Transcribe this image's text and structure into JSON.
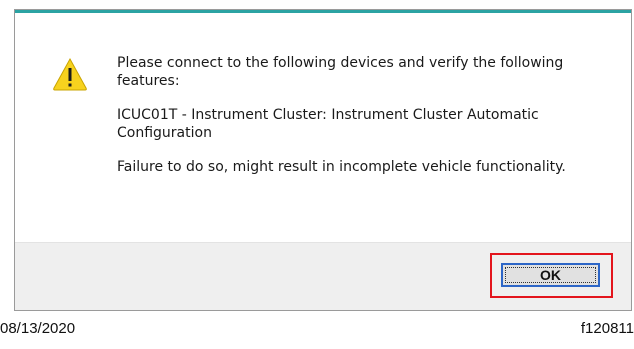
{
  "dialog": {
    "message_lines": [
      "Please connect to the following devices and verify the following features:",
      "ICUC01T - Instrument Cluster: Instrument Cluster Automatic Configuration",
      "Failure to do so, might result in incomplete vehicle functionality."
    ],
    "ok_label": "OK",
    "icon": "warning-icon",
    "accent_color": "#2ba3a3",
    "highlight_color": "#e3151d"
  },
  "caption": {
    "date": "08/13/2020",
    "figure_id": "f120811"
  }
}
